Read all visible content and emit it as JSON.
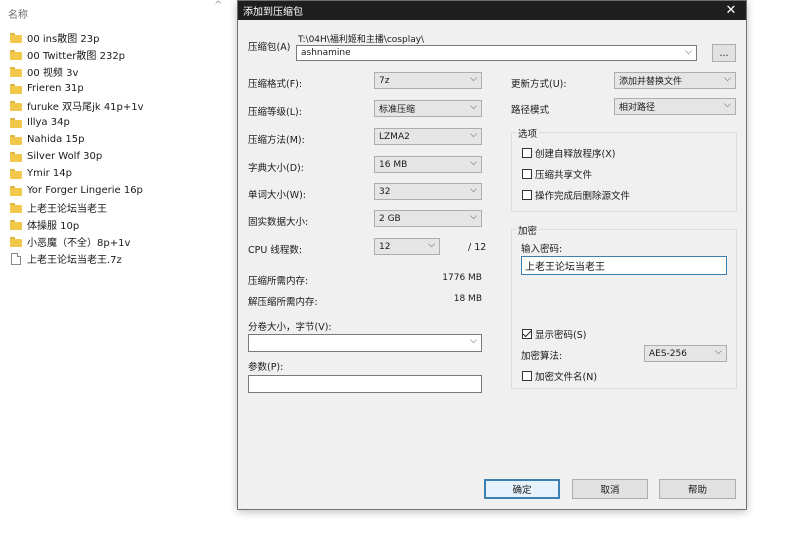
{
  "explorer": {
    "column_header": "名称",
    "items": [
      {
        "name": "00 ins散图 23p",
        "type": "folder"
      },
      {
        "name": "00 Twitter散图 232p",
        "type": "folder"
      },
      {
        "name": "00 视频 3v",
        "type": "folder"
      },
      {
        "name": "Frieren 31p",
        "type": "folder"
      },
      {
        "name": "furuke 双马尾jk 41p+1v",
        "type": "folder"
      },
      {
        "name": "Illya 34p",
        "type": "folder"
      },
      {
        "name": "Nahida 15p",
        "type": "folder"
      },
      {
        "name": "Silver Wolf 30p",
        "type": "folder"
      },
      {
        "name": "Ymir 14p",
        "type": "folder"
      },
      {
        "name": "Yor Forger Lingerie 16p",
        "type": "folder"
      },
      {
        "name": "上老王论坛当老王",
        "type": "folder"
      },
      {
        "name": "体操服 10p",
        "type": "folder"
      },
      {
        "name": "小恶魔（不全）8p+1v",
        "type": "folder"
      },
      {
        "name": "上老王论坛当老王.7z",
        "type": "file"
      }
    ]
  },
  "dialog": {
    "title": "添加到压缩包",
    "close_glyph": "✕",
    "archive": {
      "label": "压缩包(A)",
      "path": "T:\\04H\\福利姬和主播\\cosplay\\",
      "name": "ashnamine",
      "browse_label": "..."
    },
    "left": {
      "format": {
        "label": "压缩格式(F):",
        "value": "7z"
      },
      "level": {
        "label": "压缩等级(L):",
        "value": "标准压缩"
      },
      "method": {
        "label": "压缩方法(M):",
        "value": "LZMA2"
      },
      "dict": {
        "label": "字典大小(D):",
        "value": "16 MB"
      },
      "word": {
        "label": "单词大小(W):",
        "value": "32"
      },
      "solid": {
        "label": "固实数据大小:",
        "value": "2 GB"
      },
      "cpu": {
        "label": "CPU 线程数:",
        "value": "12",
        "max": "/ 12"
      },
      "mem_compress": {
        "label": "压缩所需内存:",
        "value": "1776 MB"
      },
      "mem_decompress": {
        "label": "解压缩所需内存:",
        "value": "18 MB"
      },
      "volume": {
        "label": "分卷大小，字节(V):",
        "value": ""
      },
      "params": {
        "label": "参数(P):",
        "value": ""
      }
    },
    "right": {
      "update": {
        "label": "更新方式(U):",
        "value": "添加并替换文件"
      },
      "path_mode": {
        "label": "路径模式",
        "value": "相对路径"
      },
      "options": {
        "title": "选项",
        "sfx": "创建自释放程序(X)",
        "shared": "压缩共享文件",
        "delete": "操作完成后删除源文件"
      },
      "encryption": {
        "title": "加密",
        "password_label": "输入密码:",
        "password_value": "上老王论坛当老王",
        "show_password": "显示密码(S)",
        "method_label": "加密算法:",
        "method_value": "AES-256",
        "encrypt_names": "加密文件名(N)"
      }
    },
    "buttons": {
      "ok": "确定",
      "cancel": "取消",
      "help": "帮助"
    }
  }
}
